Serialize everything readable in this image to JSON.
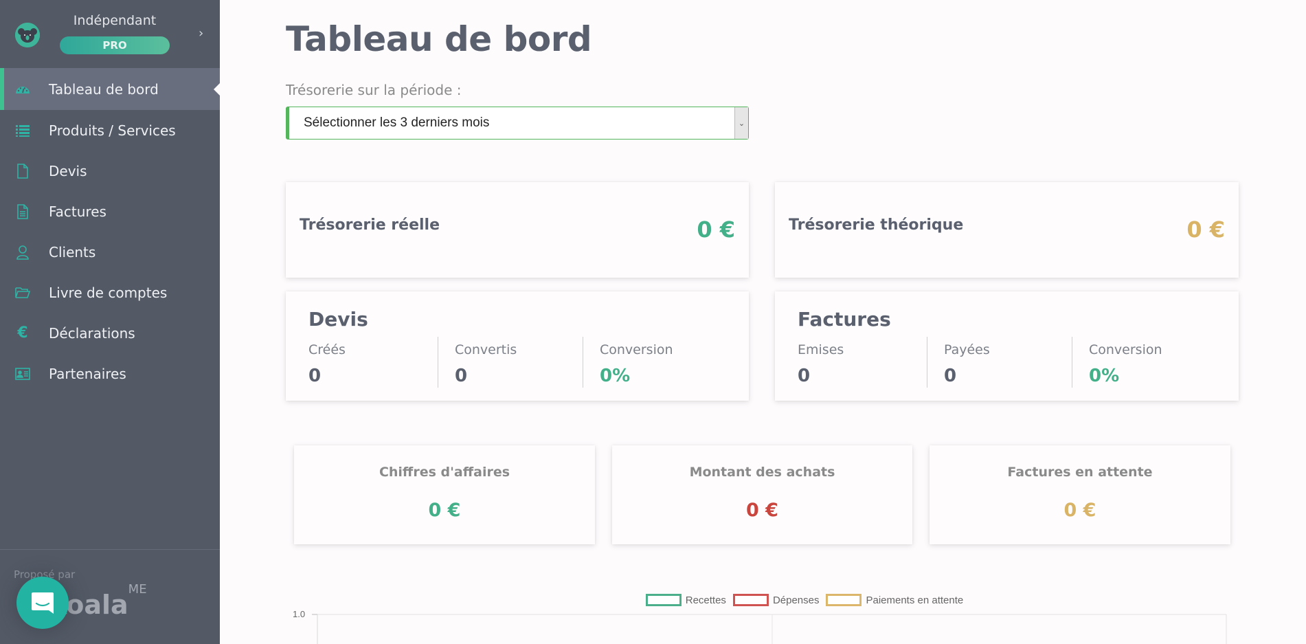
{
  "brand": {
    "account_name": "Indépendant",
    "plan_badge": "PRO",
    "expand_icon": "chevron-right-icon"
  },
  "sidebar": {
    "items": [
      {
        "label": "Tableau de bord",
        "icon": "dashboard-gauge-icon",
        "active": true
      },
      {
        "label": "Produits / Services",
        "icon": "list-icon",
        "active": false
      },
      {
        "label": "Devis",
        "icon": "document-icon",
        "active": false
      },
      {
        "label": "Factures",
        "icon": "invoice-icon",
        "active": false
      },
      {
        "label": "Clients",
        "icon": "user-icon",
        "active": false
      },
      {
        "label": "Livre de comptes",
        "icon": "folder-open-icon",
        "active": false
      },
      {
        "label": "Déclarations",
        "icon": "euro-icon",
        "active": false
      },
      {
        "label": "Partenaires",
        "icon": "id-card-icon",
        "active": false
      }
    ],
    "footer": {
      "proposed_by": "Proposé par",
      "logo_text": "koala",
      "logo_sup": "ME"
    }
  },
  "main": {
    "title": "Tableau de bord",
    "period_label": "Trésorerie sur la période :",
    "period_select": "Sélectionner les 3 derniers mois",
    "treasury": {
      "real": {
        "label": "Trésorerie réelle",
        "value": "0 €",
        "color": "#43b08a"
      },
      "theoretical": {
        "label": "Trésorerie théorique",
        "value": "0 €",
        "color": "#d9b466"
      }
    },
    "quotes": {
      "title": "Devis",
      "stats": [
        {
          "label": "Créés",
          "value": "0"
        },
        {
          "label": "Convertis",
          "value": "0"
        },
        {
          "label": "Conversion",
          "value": "0%"
        }
      ]
    },
    "invoices": {
      "title": "Factures",
      "stats": [
        {
          "label": "Emises",
          "value": "0"
        },
        {
          "label": "Payées",
          "value": "0"
        },
        {
          "label": "Conversion",
          "value": "0%"
        }
      ]
    },
    "kpis": [
      {
        "label": "Chiffres d'affaires",
        "value": "0 €",
        "color": "#43b08a"
      },
      {
        "label": "Montant des achats",
        "value": "0 €",
        "color": "#c9463f"
      },
      {
        "label": "Factures en attente",
        "value": "0 €",
        "color": "#d9b466"
      }
    ]
  },
  "chart": {
    "legend": [
      {
        "label": "Recettes",
        "color": "#4caf8c"
      },
      {
        "label": "Dépenses",
        "color": "#cf5350"
      },
      {
        "label": "Paiements en attente",
        "color": "#dcb66a"
      }
    ],
    "y_top_tick": "1.0"
  },
  "chat": {
    "icon": "chat-bubble-icon"
  }
}
